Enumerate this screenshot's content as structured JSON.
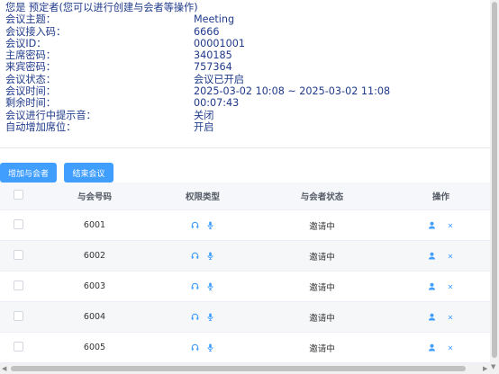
{
  "info": {
    "header": "您是 预定者(您可以进行创建与会者等操作)",
    "rows": [
      {
        "label": "会议主题：",
        "value": "Meeting"
      },
      {
        "label": "会议接入码：",
        "value": "6666"
      },
      {
        "label": "会议ID：",
        "value": "00001001"
      },
      {
        "label": "主席密码：",
        "value": "340185"
      },
      {
        "label": "来宾密码：",
        "value": "757364"
      },
      {
        "label": "会议状态：",
        "value": "会议已开启"
      },
      {
        "label": "会议时间：",
        "value": "2025-03-02 10:08 ~ 2025-03-02 11:08"
      },
      {
        "label": "剩余时间：",
        "value": "00:07:43"
      },
      {
        "label": "会议进行中提示音：",
        "value": "关闭"
      },
      {
        "label": "自动增加席位：",
        "value": "开启"
      }
    ]
  },
  "toolbar": {
    "add_label": "增加与会者",
    "end_label": "结束会议"
  },
  "table": {
    "headers": [
      "与会号码",
      "权限类型",
      "与会者状态",
      "操作"
    ],
    "rows": [
      {
        "number": "6001",
        "status": "邀请中"
      },
      {
        "number": "6002",
        "status": "邀请中"
      },
      {
        "number": "6003",
        "status": "邀请中"
      },
      {
        "number": "6004",
        "status": "邀请中"
      },
      {
        "number": "6005",
        "status": "邀请中"
      }
    ]
  },
  "colors": {
    "accent": "#409eff",
    "text": "#1f3a8a"
  },
  "icons": {
    "permission": [
      "headset-icon",
      "microphone-icon"
    ],
    "actions": [
      "user-icon",
      "close-icon"
    ]
  }
}
